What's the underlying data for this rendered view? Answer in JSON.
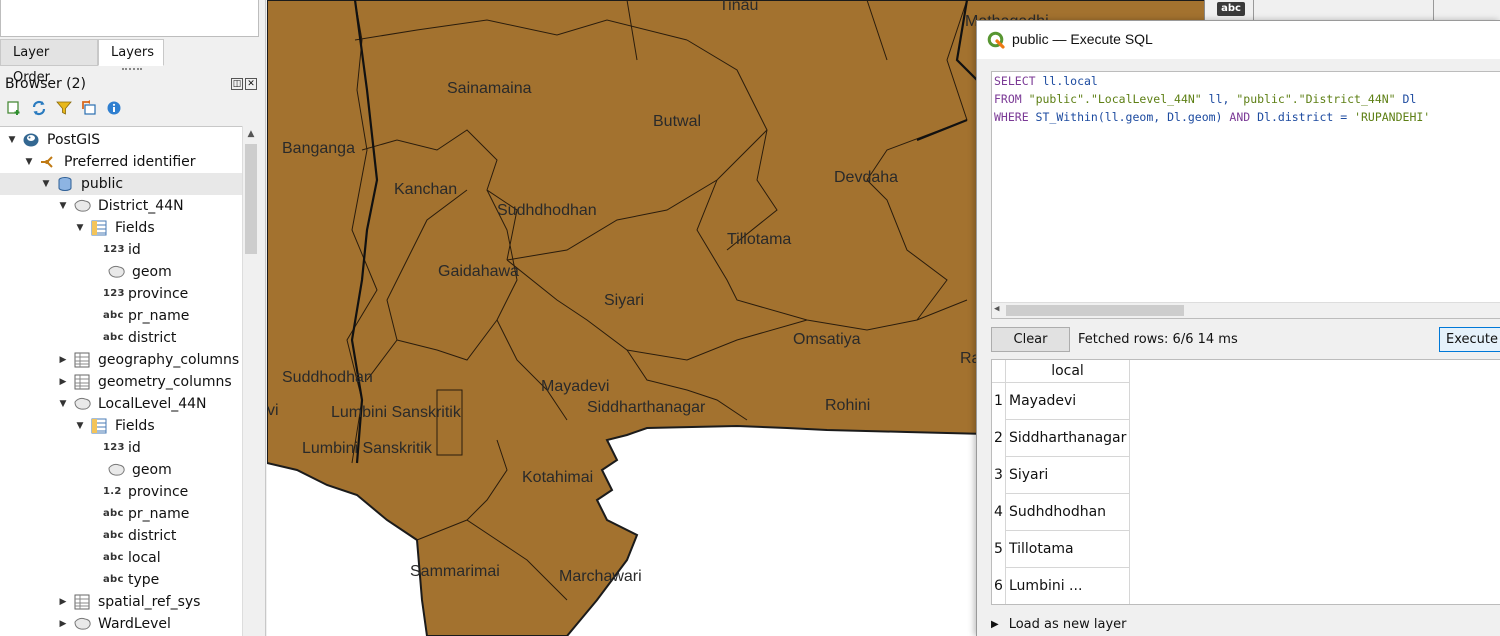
{
  "layers_panel": {
    "tabs": [
      {
        "label": "Layer Order",
        "active": false
      },
      {
        "label": "Layers",
        "active": true
      }
    ]
  },
  "browser": {
    "title": "Browser (2)",
    "toolbar_icons": [
      "add-layer-icon",
      "refresh-icon",
      "filter-icon",
      "collapse-all-icon",
      "info-icon"
    ],
    "tree": [
      {
        "label": "PostGIS",
        "depth": 0,
        "expander": "open",
        "icon": "postgis-icon"
      },
      {
        "label": "Preferred identifier",
        "depth": 1,
        "expander": "open",
        "icon": "connection-icon"
      },
      {
        "label": "public",
        "depth": 2,
        "expander": "open",
        "icon": "schema-icon",
        "selected": true
      },
      {
        "label": "District_44N",
        "depth": 3,
        "expander": "open",
        "icon": "polygon-layer-icon"
      },
      {
        "label": "Fields",
        "depth": 4,
        "expander": "open",
        "icon": "fields-icon"
      },
      {
        "label": "id",
        "depth": 5,
        "expander": "none",
        "icon": "integer-field-icon",
        "type_text": "123"
      },
      {
        "label": "geom",
        "depth": 5,
        "expander": "none",
        "icon": "geometry-field-icon"
      },
      {
        "label": "province",
        "depth": 5,
        "expander": "none",
        "icon": "integer-field-icon",
        "type_text": "123"
      },
      {
        "label": "pr_name",
        "depth": 5,
        "expander": "none",
        "icon": "text-field-icon",
        "type_text": "abc"
      },
      {
        "label": "district",
        "depth": 5,
        "expander": "none",
        "icon": "text-field-icon",
        "type_text": "abc"
      },
      {
        "label": "geography_columns",
        "depth": 3,
        "expander": "closed",
        "icon": "table-icon"
      },
      {
        "label": "geometry_columns",
        "depth": 3,
        "expander": "closed",
        "icon": "table-icon"
      },
      {
        "label": "LocalLevel_44N",
        "depth": 3,
        "expander": "open",
        "icon": "polygon-layer-icon"
      },
      {
        "label": "Fields",
        "depth": 4,
        "expander": "open",
        "icon": "fields-icon"
      },
      {
        "label": "id",
        "depth": 5,
        "expander": "none",
        "icon": "integer-field-icon",
        "type_text": "123"
      },
      {
        "label": "geom",
        "depth": 5,
        "expander": "none",
        "icon": "geometry-field-icon"
      },
      {
        "label": "province",
        "depth": 5,
        "expander": "none",
        "icon": "decimal-field-icon",
        "type_text": "1.2"
      },
      {
        "label": "pr_name",
        "depth": 5,
        "expander": "none",
        "icon": "text-field-icon",
        "type_text": "abc"
      },
      {
        "label": "district",
        "depth": 5,
        "expander": "none",
        "icon": "text-field-icon",
        "type_text": "abc"
      },
      {
        "label": "local",
        "depth": 5,
        "expander": "none",
        "icon": "text-field-icon",
        "type_text": "abc"
      },
      {
        "label": "type",
        "depth": 5,
        "expander": "none",
        "icon": "text-field-icon",
        "type_text": "abc"
      },
      {
        "label": "spatial_ref_sys",
        "depth": 3,
        "expander": "closed",
        "icon": "table-icon"
      },
      {
        "label": "WardLevel",
        "depth": 3,
        "expander": "closed",
        "icon": "polygon-layer-icon"
      }
    ]
  },
  "map": {
    "fill_color": "#a3722f",
    "labels": [
      "Tinau",
      "Mathagadhi",
      "Sainamaina",
      "Butwal",
      "Banganga",
      "Devdaha",
      "Kanchan",
      "Sudhdhodhan",
      "Tillotama",
      "Gaidahawa",
      "Siyari",
      "Omsatiya",
      "Suddhodhan",
      "Mayadevi",
      "vi",
      "Lumbini Sanskritik",
      "Siddharthanagar",
      "Rohini",
      "Lumbini Sanskritik",
      "Kotahimai",
      "Sammarimai",
      "Marchawari",
      "Ra"
    ]
  },
  "background_panel": {
    "chip_label": "abc"
  },
  "sql_window": {
    "title": "public — Execute SQL",
    "query": {
      "line1": {
        "kw": "SELECT",
        "rest": " ll.local"
      },
      "line2": {
        "kw": "FROM",
        "s1": "\"public\".\"LocalLevel_44N\"",
        "a1": " ll, ",
        "s2": "\"public\".\"District_44N\"",
        "a2": " Dl"
      },
      "line3": {
        "kw": "WHERE",
        "fn": " ST_Within(ll.geom, Dl.geom) ",
        "and": "AND",
        "cond": " Dl.district = ",
        "val": "'RUPANDEHI'"
      }
    },
    "clear_label": "Clear",
    "fetched_text": "Fetched rows: 6/6  14 ms",
    "execute_label": "Execute",
    "results": {
      "column": "local",
      "rows": [
        {
          "num": "1",
          "value": "Mayadevi"
        },
        {
          "num": "2",
          "value": "Siddharthanagar"
        },
        {
          "num": "3",
          "value": "Siyari"
        },
        {
          "num": "4",
          "value": "Sudhdhodhan"
        },
        {
          "num": "5",
          "value": "Tillotama"
        },
        {
          "num": "6",
          "value": "Lumbini ..."
        }
      ]
    },
    "load_as_layer_label": "Load as new layer"
  }
}
